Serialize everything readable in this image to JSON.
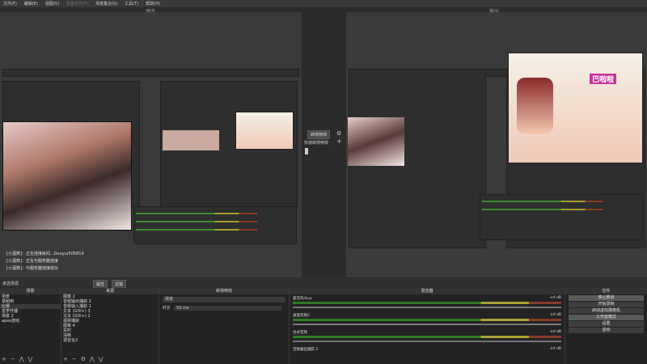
{
  "menu": [
    "文件(F)",
    "编辑(E)",
    "视图(V)",
    "配置文件(P)",
    "场景集合(S)",
    "工具(T)",
    "帮助(H)"
  ],
  "panes": {
    "preview": "预览",
    "program": "输出"
  },
  "transition_center": {
    "button": "转场特效",
    "quick": "快速转场特效"
  },
  "chat": [
    "[小酒窝]：正在连接房间...Douyu/505819",
    "[小酒窝]：正在与服务器连接",
    "[小酒窝]：与服务器连接成功"
  ],
  "bottom_bar": {
    "label": "未选择源",
    "tab1": "属性",
    "tab2": "滤镜"
  },
  "scenes": {
    "title": "场景",
    "items": [
      "场景",
      "录制用",
      "比赛",
      "去学开播",
      "场景 2",
      "apex游戏"
    ],
    "selected": 2
  },
  "sources": {
    "title": "来源",
    "items": [
      "图像 2",
      "音频输出捕获 2",
      "音频输入捕获 1",
      "文本 (GDI+) 3",
      "文本 (GDI+) 2",
      "视频捕获",
      "图像 4",
      "实时",
      "清晰",
      "调音台2"
    ]
  },
  "transitions": {
    "title": "转场特效",
    "type": "渐变",
    "duration_label": "时长",
    "duration": "50 ms"
  },
  "mixer": {
    "title": "混音器",
    "tracks": [
      {
        "name": "麦克风/Aux",
        "db": "-inf dB"
      },
      {
        "name": "桌面音频2",
        "db": "-inf dB"
      },
      {
        "name": "台式音频",
        "db": "-inf dB"
      },
      {
        "name": "音频输出捕获 2",
        "db": "-inf dB"
      }
    ]
  },
  "controls": {
    "title": "控件",
    "buttons": [
      "停止推流",
      "开始录制",
      "启动虚拟摄像机",
      "工作室模式",
      "设置",
      "退出"
    ],
    "active": [
      0,
      3
    ]
  },
  "poster_title": "巴啦啦"
}
